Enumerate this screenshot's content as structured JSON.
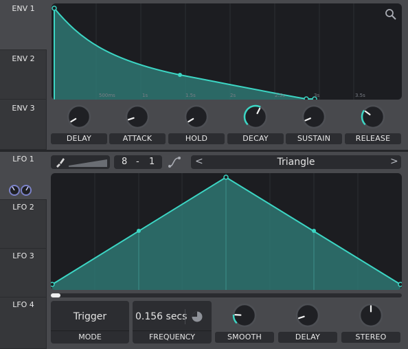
{
  "env_tabs": [
    {
      "label": "ENV 1",
      "active": true
    },
    {
      "label": "ENV 2",
      "active": false
    },
    {
      "label": "ENV 3",
      "active": false
    }
  ],
  "lfo_tabs": [
    {
      "label": "LFO 1",
      "active": true
    },
    {
      "label": "LFO 2",
      "active": false
    },
    {
      "label": "LFO 3",
      "active": false
    },
    {
      "label": "LFO 4",
      "active": false
    }
  ],
  "env_graph": {
    "time_labels": [
      "500ms",
      "1s",
      "1.5s",
      "2s",
      "2.5s",
      "3s",
      "3.5s"
    ],
    "zoom_icon": "magnifier-icon"
  },
  "env_knobs": [
    {
      "label": "DELAY",
      "value": 0.05,
      "modulated": false
    },
    {
      "label": "ATTACK",
      "value": 0.1,
      "modulated": false
    },
    {
      "label": "HOLD",
      "value": 0.05,
      "modulated": false
    },
    {
      "label": "DECAY",
      "value": 0.6,
      "modulated": true
    },
    {
      "label": "SUSTAIN",
      "value": 0.08,
      "modulated": false
    },
    {
      "label": "RELEASE",
      "value": 0.3,
      "modulated": true
    }
  ],
  "lfo_toolbar": {
    "grid_x": "8",
    "dash": "-",
    "grid_y": "1",
    "shape_name": "Triangle",
    "prev": "<",
    "next": ">"
  },
  "lfo_bottom": {
    "mode_value": "Trigger",
    "mode_label": "MODE",
    "frequency_value": "0.156 secs",
    "frequency_label": "FREQUENCY"
  },
  "lfo_knobs": [
    {
      "label": "SMOOTH",
      "value": 0.18,
      "modulated": true
    },
    {
      "label": "DELAY",
      "value": 0.1,
      "modulated": false
    },
    {
      "label": "STEREO",
      "value": 0.5,
      "modulated": false
    }
  ],
  "colors": {
    "accent": "#3cd6c4",
    "bg": "#3b3c40",
    "panel": "#2c2d31",
    "graph": "#1c1d21",
    "knob_ring": "#4d4f54",
    "knob_mod": "#7b82c8"
  }
}
